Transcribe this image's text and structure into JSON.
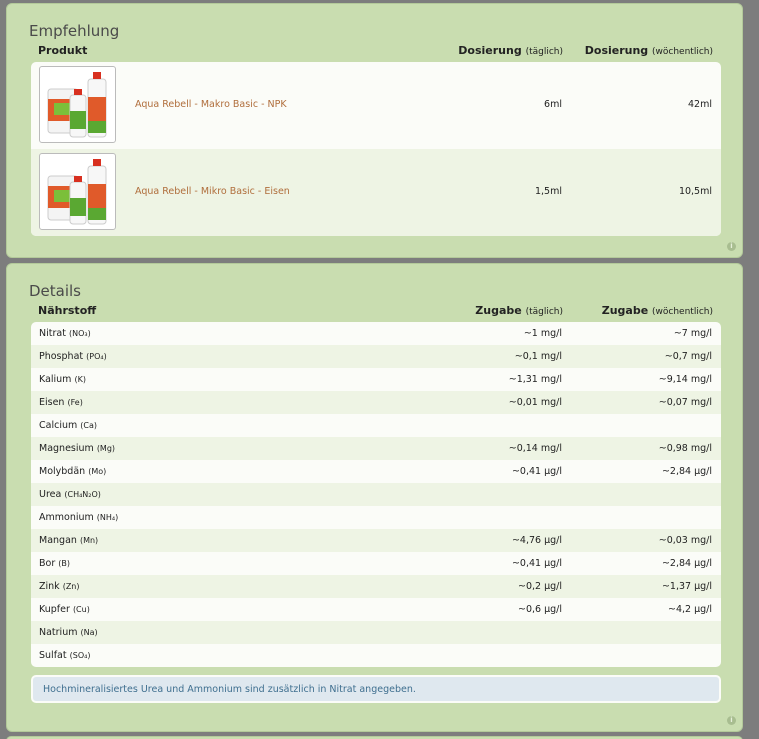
{
  "empfehlung": {
    "title": "Empfehlung",
    "header": {
      "product": "Produkt",
      "daily_label": "Dosierung",
      "daily_unit": "(täglich)",
      "weekly_label": "Dosierung",
      "weekly_unit": "(wöchentlich)"
    },
    "products": [
      {
        "name": "Aqua Rebell - Makro Basic - NPK",
        "daily": "6ml",
        "weekly": "42ml"
      },
      {
        "name": "Aqua Rebell - Mikro Basic - Eisen",
        "daily": "1,5ml",
        "weekly": "10,5ml"
      }
    ]
  },
  "details": {
    "title": "Details",
    "header": {
      "nutrient": "Nährstoff",
      "daily_label": "Zugabe",
      "daily_unit": "(täglich)",
      "weekly_label": "Zugabe",
      "weekly_unit": "(wöchentlich)"
    },
    "rows": [
      {
        "name": "Nitrat",
        "formula": "(NO₃)",
        "daily": "~1 mg/l",
        "weekly": "~7 mg/l"
      },
      {
        "name": "Phosphat",
        "formula": "(PO₄)",
        "daily": "~0,1 mg/l",
        "weekly": "~0,7 mg/l"
      },
      {
        "name": "Kalium",
        "formula": "(K)",
        "daily": "~1,31 mg/l",
        "weekly": "~9,14 mg/l"
      },
      {
        "name": "Eisen",
        "formula": "(Fe)",
        "daily": "~0,01 mg/l",
        "weekly": "~0,07 mg/l"
      },
      {
        "name": "Calcium",
        "formula": "(Ca)",
        "daily": "",
        "weekly": ""
      },
      {
        "name": "Magnesium",
        "formula": "(Mg)",
        "daily": "~0,14 mg/l",
        "weekly": "~0,98 mg/l"
      },
      {
        "name": "Molybdän",
        "formula": "(Mo)",
        "daily": "~0,41 µg/l",
        "weekly": "~2,84 µg/l"
      },
      {
        "name": "Urea",
        "formula": "(CH₄N₂O)",
        "daily": "",
        "weekly": ""
      },
      {
        "name": "Ammonium",
        "formula": "(NH₄)",
        "daily": "",
        "weekly": ""
      },
      {
        "name": "Mangan",
        "formula": "(Mn)",
        "daily": "~4,76 µg/l",
        "weekly": "~0,03 mg/l"
      },
      {
        "name": "Bor",
        "formula": "(B)",
        "daily": "~0,41 µg/l",
        "weekly": "~2,84 µg/l"
      },
      {
        "name": "Zink",
        "formula": "(Zn)",
        "daily": "~0,2 µg/l",
        "weekly": "~1,37 µg/l"
      },
      {
        "name": "Kupfer",
        "formula": "(Cu)",
        "daily": "~0,6 µg/l",
        "weekly": "~4,2 µg/l"
      },
      {
        "name": "Natrium",
        "formula": "(Na)",
        "daily": "",
        "weekly": ""
      },
      {
        "name": "Sulfat",
        "formula": "(SO₄)",
        "daily": "",
        "weekly": ""
      }
    ],
    "note": "Hochmineralisiertes Urea und Ammonium sind zusätzlich in Nitrat angegeben."
  },
  "icons": {
    "info": "info-icon",
    "product_image": "fertilizer-bottles-image"
  },
  "colors": {
    "panel_bg": "#c9ddb0",
    "row_alt": "#eef4e4",
    "product_link": "#b06e3c",
    "note_bg": "#dfe8ef",
    "note_text": "#3f6f8f"
  }
}
